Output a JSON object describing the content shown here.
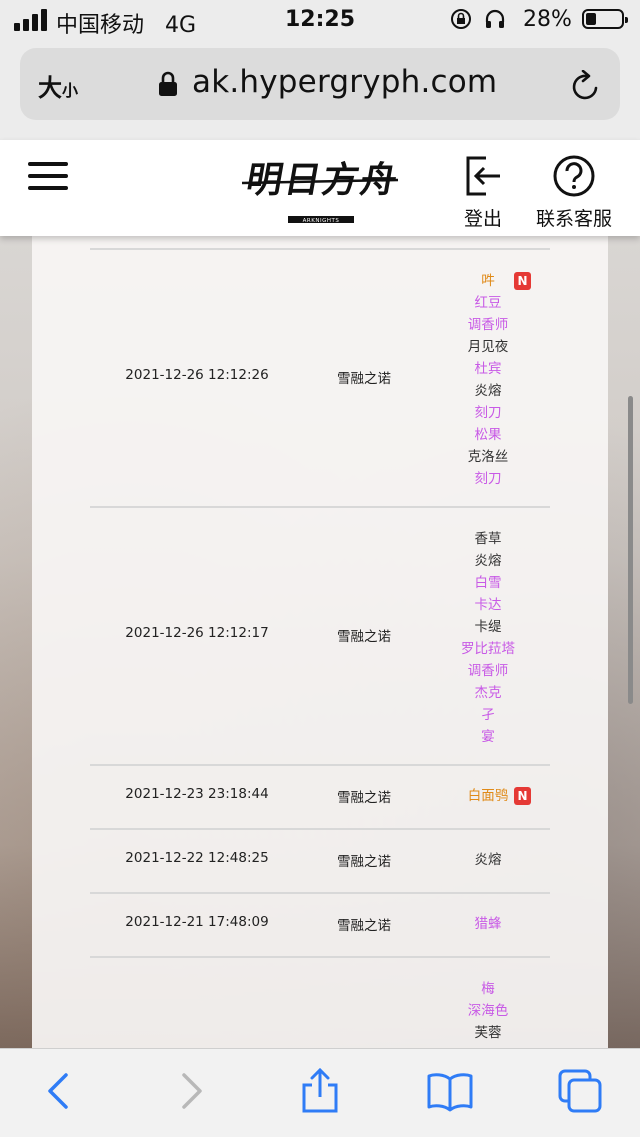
{
  "status_bar": {
    "carrier": "中国移动",
    "network": "4G",
    "time": "12:25",
    "battery_percent": "28%",
    "battery_level": 0.28
  },
  "address_bar": {
    "text_size_label_large": "大",
    "text_size_label_small": "小",
    "url": "ak.hypergryph.com"
  },
  "header": {
    "logout_label": "登出",
    "support_label": "联系客服",
    "logo_text": "明日方舟",
    "logo_subtext": "ARKNIGHTS"
  },
  "records": [
    {
      "time": "2021-12-26 12:12:26",
      "pool": "雪融之诺",
      "characters": [
        {
          "name": "吽",
          "rarity": "6",
          "new": true,
          "new_label": "N"
        },
        {
          "name": "红豆",
          "rarity": "5"
        },
        {
          "name": "调香师",
          "rarity": "5"
        },
        {
          "name": "月见夜",
          "rarity": "4"
        },
        {
          "name": "杜宾",
          "rarity": "5"
        },
        {
          "name": "炎熔",
          "rarity": "4"
        },
        {
          "name": "刻刀",
          "rarity": "5"
        },
        {
          "name": "松果",
          "rarity": "5"
        },
        {
          "name": "克洛丝",
          "rarity": "4"
        },
        {
          "name": "刻刀",
          "rarity": "5"
        }
      ]
    },
    {
      "time": "2021-12-26 12:12:17",
      "pool": "雪融之诺",
      "characters": [
        {
          "name": "香草",
          "rarity": "4"
        },
        {
          "name": "炎熔",
          "rarity": "4"
        },
        {
          "name": "白雪",
          "rarity": "5"
        },
        {
          "name": "卡达",
          "rarity": "5"
        },
        {
          "name": "卡缇",
          "rarity": "4"
        },
        {
          "name": "罗比菈塔",
          "rarity": "5"
        },
        {
          "name": "调香师",
          "rarity": "5"
        },
        {
          "name": "杰克",
          "rarity": "5"
        },
        {
          "name": "孑",
          "rarity": "5"
        },
        {
          "name": "宴",
          "rarity": "5"
        }
      ]
    },
    {
      "time": "2021-12-23 23:18:44",
      "pool": "雪融之诺",
      "characters": [
        {
          "name": "白面鸮",
          "rarity": "6",
          "new": true,
          "new_label": "N"
        }
      ]
    },
    {
      "time": "2021-12-22 12:48:25",
      "pool": "雪融之诺",
      "characters": [
        {
          "name": "炎熔",
          "rarity": "4"
        }
      ]
    },
    {
      "time": "2021-12-21 17:48:09",
      "pool": "雪融之诺",
      "characters": [
        {
          "name": "猎蜂",
          "rarity": "5"
        }
      ]
    },
    {
      "time": "",
      "pool": "",
      "characters": [
        {
          "name": "梅",
          "rarity": "5"
        },
        {
          "name": "深海色",
          "rarity": "5"
        },
        {
          "name": "芙蓉",
          "rarity": "4"
        }
      ]
    }
  ],
  "colors": {
    "rarity_6": "#e08a18",
    "rarity_5": "#c85ae6",
    "rarity_4": "#333333",
    "new_badge": "#e53935",
    "safari_blue": "#2f7cf6"
  },
  "toolbar": {
    "icons": [
      "back-icon",
      "forward-icon",
      "share-icon",
      "bookmarks-icon",
      "tabs-icon"
    ]
  }
}
